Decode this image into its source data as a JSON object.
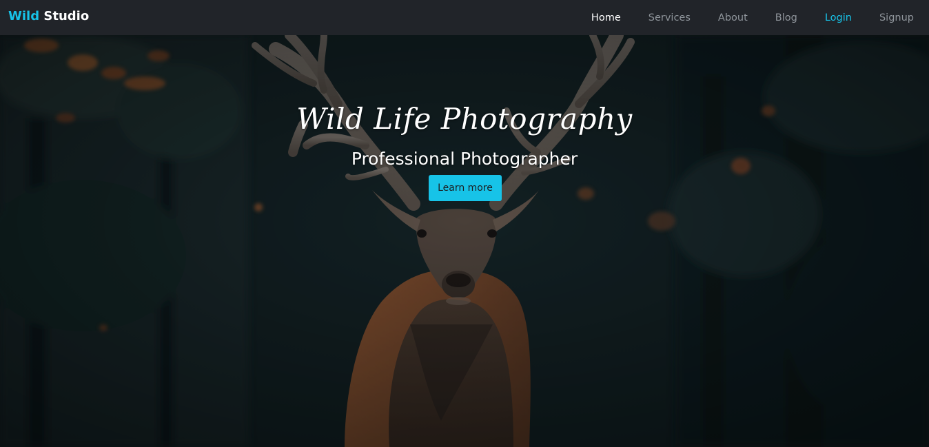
{
  "navbar": {
    "brand_accent": "Wild",
    "brand_rest": "Studio",
    "links": [
      {
        "label": "Home"
      },
      {
        "label": "Services"
      },
      {
        "label": "About"
      },
      {
        "label": "Blog"
      },
      {
        "label": "Login"
      },
      {
        "label": "Signup"
      }
    ]
  },
  "hero": {
    "script_title": "Wild Life Photography",
    "subtitle": "Professional Photographer",
    "cta_label": "Learn more",
    "background_image": "red-deer-stag-in-dark-forest"
  },
  "colors": {
    "accent": "#17c3e8",
    "navbar_bg": "#212429",
    "nav_text": "#8f959b",
    "nav_active": "#ffffff"
  }
}
